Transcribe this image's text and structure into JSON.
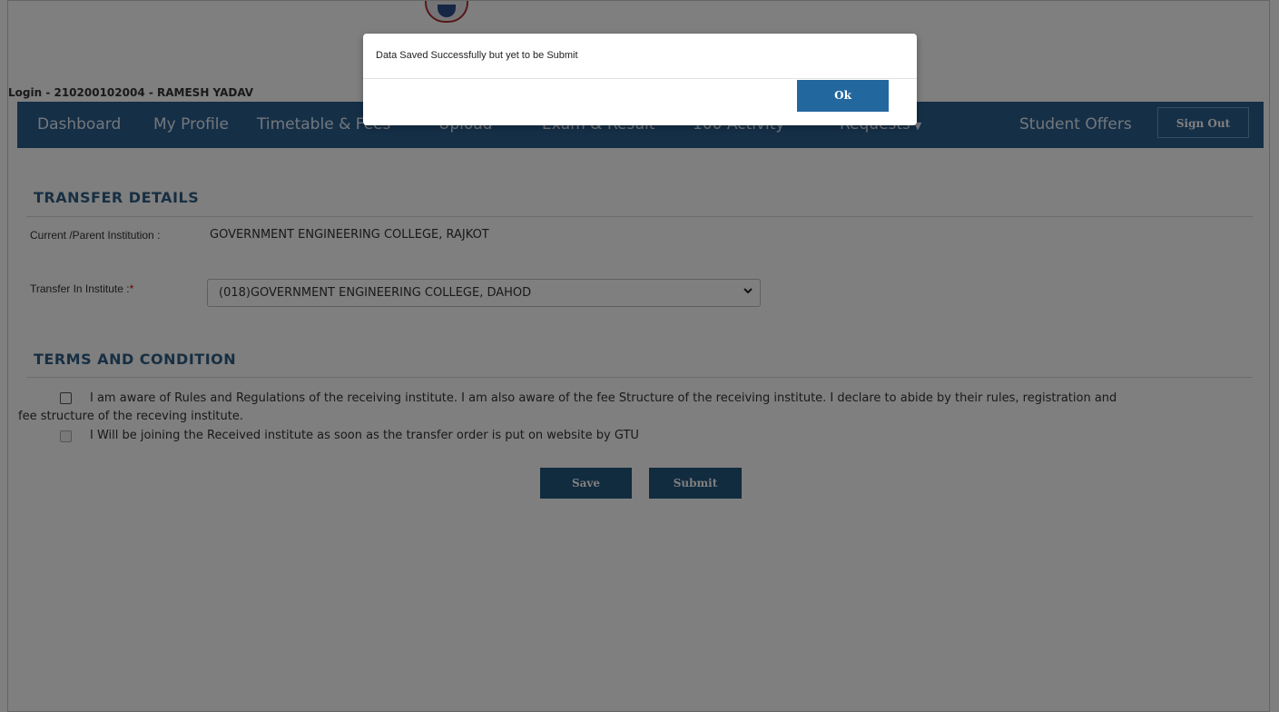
{
  "header": {
    "login_text": "Login - 210200102004 - RAMESH YADAV"
  },
  "nav": {
    "items": [
      "Dashboard",
      "My Profile",
      "Timetable & Fees",
      "Upload",
      "Exam & Result",
      "100 Activity",
      "Requests"
    ],
    "student_offers": "Student Offers",
    "sign_out": "Sign Out",
    "bar_color": "#2a5f8f"
  },
  "transfer": {
    "section_title": "TRANSFER DETAILS",
    "current_label": "Current /Parent Institution :",
    "current_value": "GOVERNMENT ENGINEERING COLLEGE, RAJKOT",
    "transfer_in_label": "Transfer In Institute :",
    "required_mark": "*",
    "transfer_in_selected": "(018)GOVERNMENT ENGINEERING COLLEGE, DAHOD"
  },
  "terms": {
    "section_title": "TERMS AND CONDITION",
    "item1_line1": "I am aware of Rules and Regulations of the receiving institute. I am also aware of the fee Structure of the receiving institute. I declare to abide by their rules, registration and",
    "item1_line2": "fee structure of the receving institute.",
    "item2": "I Will be joining the Received institute as soon as the transfer order is put on website by GTU"
  },
  "actions": {
    "save": "Save",
    "submit": "Submit",
    "button_color": "#23567f"
  },
  "modal": {
    "message": "Data Saved Successfully but yet to be Submit",
    "ok": "Ok"
  },
  "icons": {
    "logo": "university-seal",
    "dropdown": "chevron-down-icon",
    "requests_caret": "caret-down-icon"
  }
}
